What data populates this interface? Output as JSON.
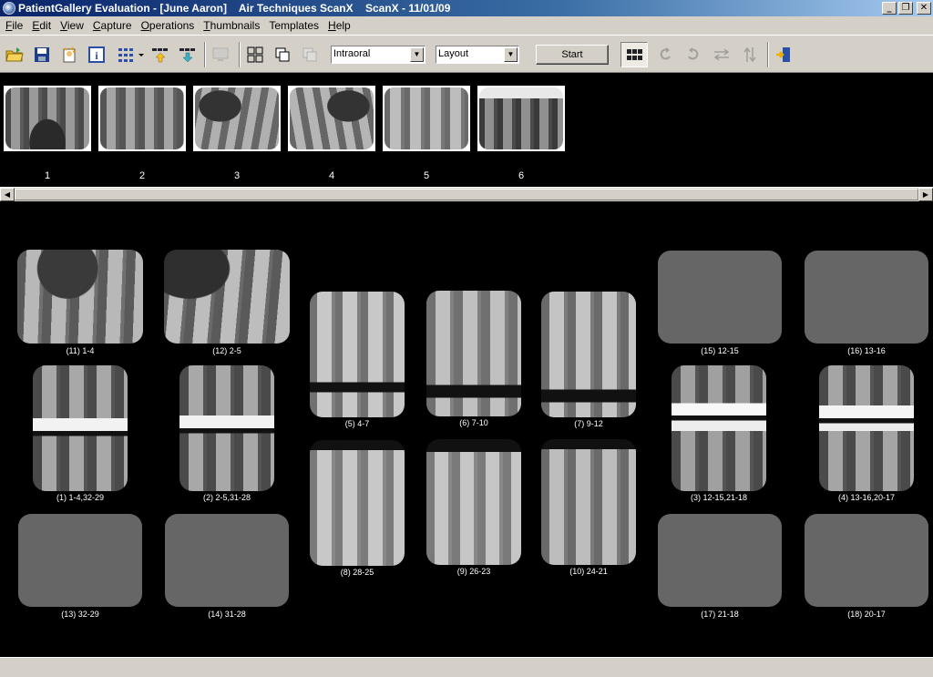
{
  "window": {
    "title": "PatientGallery Evaluation - [June Aaron]    Air Techniques ScanX    ScanX - 11/01/09",
    "minimize": "_",
    "restore": "❐",
    "close": "✕"
  },
  "menu": [
    {
      "label": "File",
      "accel": "F",
      "rest": "ile"
    },
    {
      "label": "Edit",
      "accel": "E",
      "rest": "dit"
    },
    {
      "label": "View",
      "accel": "V",
      "rest": "iew"
    },
    {
      "label": "Capture",
      "accel": "C",
      "rest": "apture"
    },
    {
      "label": "Operations",
      "accel": "O",
      "rest": "perations"
    },
    {
      "label": "Thumbnails",
      "accel": "T",
      "rest": "humbnails"
    },
    {
      "label": "Templates",
      "accel": "",
      "rest": "Templates"
    },
    {
      "label": "Help",
      "accel": "H",
      "rest": "elp"
    }
  ],
  "toolbar": {
    "mode_select": "Intraoral",
    "layout_select": "Layout",
    "start_label": "Start",
    "icons": [
      "open-folder-icon",
      "save-icon",
      "new-patient-icon",
      "info-icon",
      "thumbnail-grid-icon",
      "move-up-icon",
      "move-down-icon",
      "monitor-icon",
      "template-grid-icon",
      "copy-icon",
      "paste-icon",
      "layout-view-icon",
      "rotate-left-icon",
      "rotate-right-icon",
      "flip-horizontal-icon",
      "flip-vertical-icon",
      "exit-icon"
    ]
  },
  "thumbnails": [
    {
      "num": "1"
    },
    {
      "num": "2"
    },
    {
      "num": "3"
    },
    {
      "num": "4"
    },
    {
      "num": "5"
    },
    {
      "num": "6"
    }
  ],
  "slots": [
    {
      "label": "(11) 1-4",
      "filled": true
    },
    {
      "label": "(12) 2-5",
      "filled": true
    },
    {
      "label": "(5) 4-7",
      "filled": true
    },
    {
      "label": "(6) 7-10",
      "filled": true
    },
    {
      "label": "(7) 9-12",
      "filled": true
    },
    {
      "label": "(15) 12-15",
      "filled": false
    },
    {
      "label": "(16) 13-16",
      "filled": false
    },
    {
      "label": "(1) 1-4,32-29",
      "filled": true
    },
    {
      "label": "(2) 2-5,31-28",
      "filled": true
    },
    {
      "label": "(3) 12-15,21-18",
      "filled": true
    },
    {
      "label": "(4) 13-16,20-17",
      "filled": true
    },
    {
      "label": "(8) 28-25",
      "filled": true
    },
    {
      "label": "(9) 26-23",
      "filled": true
    },
    {
      "label": "(10) 24-21",
      "filled": true
    },
    {
      "label": "(13) 32-29",
      "filled": false
    },
    {
      "label": "(14) 31-28",
      "filled": false
    },
    {
      "label": "(17) 21-18",
      "filled": false
    },
    {
      "label": "(18) 20-17",
      "filled": false
    }
  ]
}
